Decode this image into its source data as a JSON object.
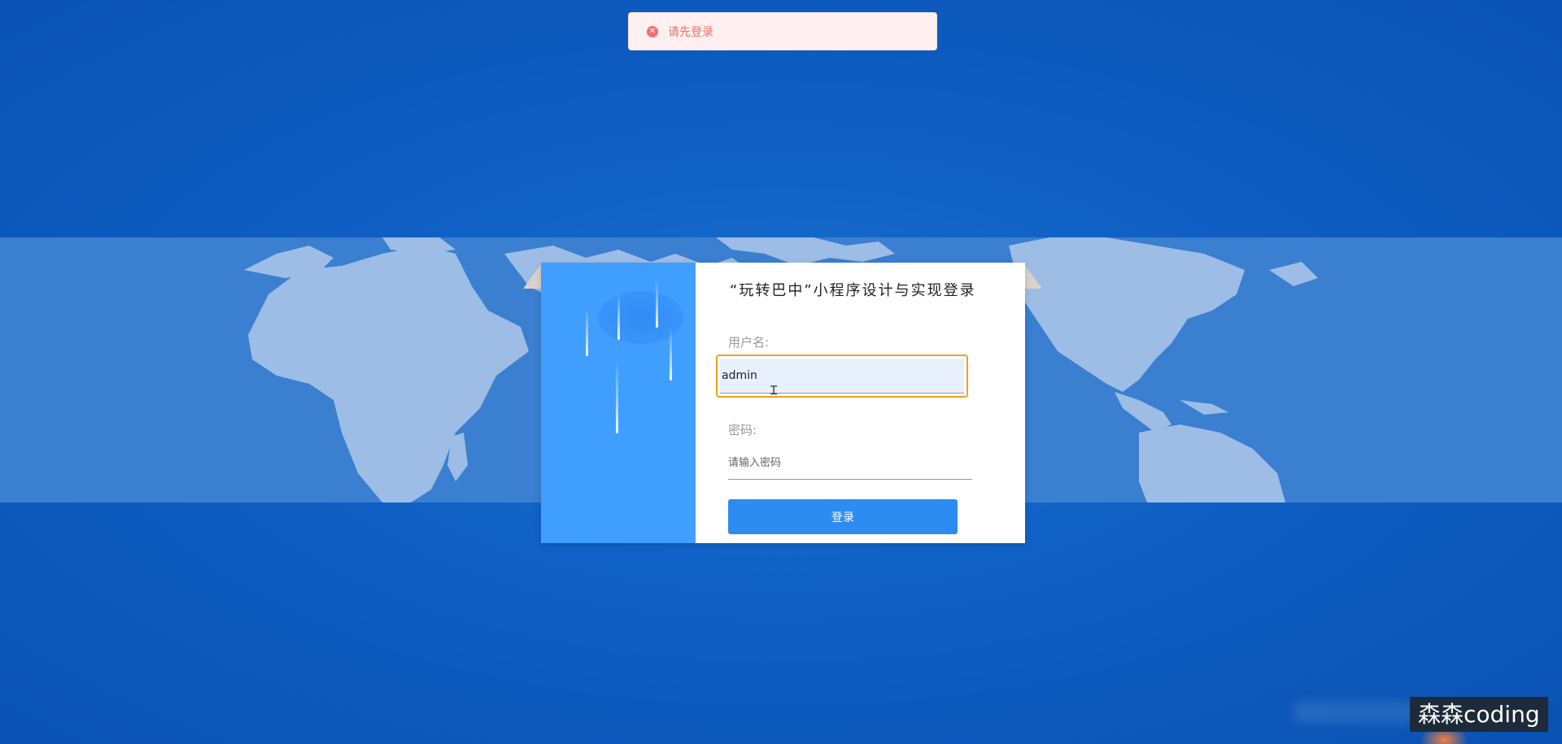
{
  "toast": {
    "icon": "error-circle-icon",
    "message": "请先登录",
    "color": "#f56c6c"
  },
  "login": {
    "title": "“玩转巴中”小程序设计与实现登录",
    "username_label": "用户名:",
    "username_value": "admin",
    "password_label": "密码:",
    "password_placeholder": "请输入密码",
    "submit_label": "登录",
    "accent_color": "#409eff"
  },
  "watermark": {
    "text": "森森coding"
  },
  "colors": {
    "background": "#0f5fc4",
    "map_band": "#3a7fd0",
    "input_focus_border": "#f0a020"
  }
}
